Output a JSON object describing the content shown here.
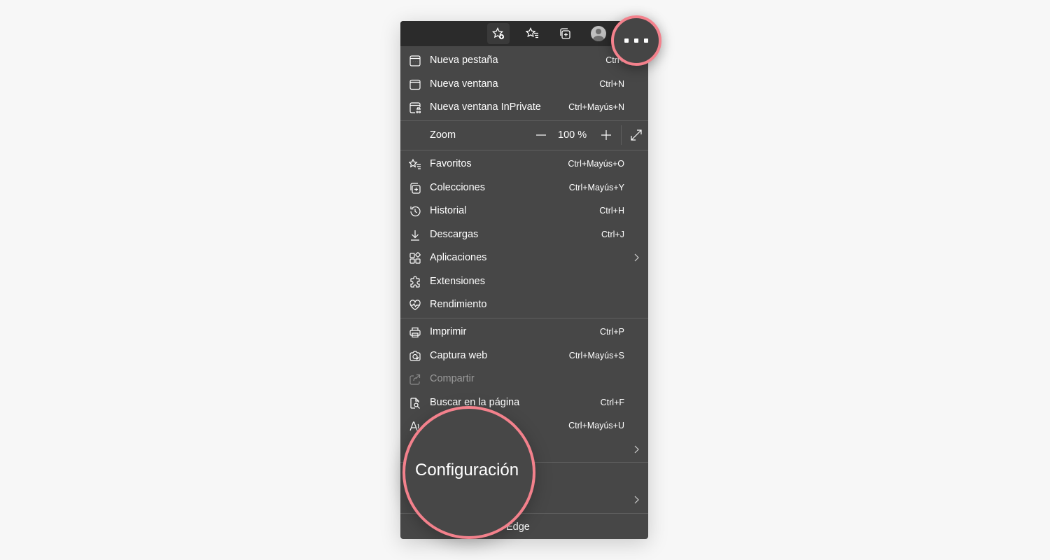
{
  "toolbar": {
    "icons": [
      "favorite-add-icon",
      "favorites-icon",
      "collections-icon",
      "profile-avatar",
      "more-options-icon"
    ]
  },
  "menu": {
    "items_top": [
      {
        "label": "Nueva pestaña",
        "shortcut": "Ctrl+",
        "icon": "new-tab-icon"
      },
      {
        "label": "Nueva ventana",
        "shortcut": "Ctrl+N",
        "icon": "new-window-icon"
      },
      {
        "label": "Nueva ventana InPrivate",
        "shortcut": "Ctrl+Mayús+N",
        "icon": "inprivate-window-icon"
      }
    ],
    "zoom": {
      "label": "Zoom",
      "value": "100 %"
    },
    "items_mid": [
      {
        "label": "Favoritos",
        "shortcut": "Ctrl+Mayús+O",
        "icon": "favorites-icon"
      },
      {
        "label": "Colecciones",
        "shortcut": "Ctrl+Mayús+Y",
        "icon": "collections-icon"
      },
      {
        "label": "Historial",
        "shortcut": "Ctrl+H",
        "icon": "history-icon"
      },
      {
        "label": "Descargas",
        "shortcut": "Ctrl+J",
        "icon": "download-icon"
      },
      {
        "label": "Aplicaciones",
        "shortcut": "",
        "icon": "apps-icon",
        "submenu": true
      },
      {
        "label": "Extensiones",
        "shortcut": "",
        "icon": "extensions-icon"
      },
      {
        "label": "Rendimiento",
        "shortcut": "",
        "icon": "performance-icon"
      }
    ],
    "items_low": [
      {
        "label": "Imprimir",
        "shortcut": "Ctrl+P",
        "icon": "print-icon"
      },
      {
        "label": "Captura web",
        "shortcut": "Ctrl+Mayús+S",
        "icon": "web-capture-icon"
      },
      {
        "label": "Compartir",
        "shortcut": "",
        "icon": "share-icon",
        "disabled": true
      },
      {
        "label": "Buscar en la página",
        "shortcut": "Ctrl+F",
        "icon": "find-in-page-icon"
      },
      {
        "label": "",
        "shortcut": "Ctrl+Mayús+U",
        "icon": "read-aloud-icon"
      }
    ],
    "bottom_item": {
      "label": "Edge",
      "icon": "edge-icon"
    }
  },
  "highlight": {
    "label": "Configuración",
    "ring_color": "#f3818c"
  }
}
